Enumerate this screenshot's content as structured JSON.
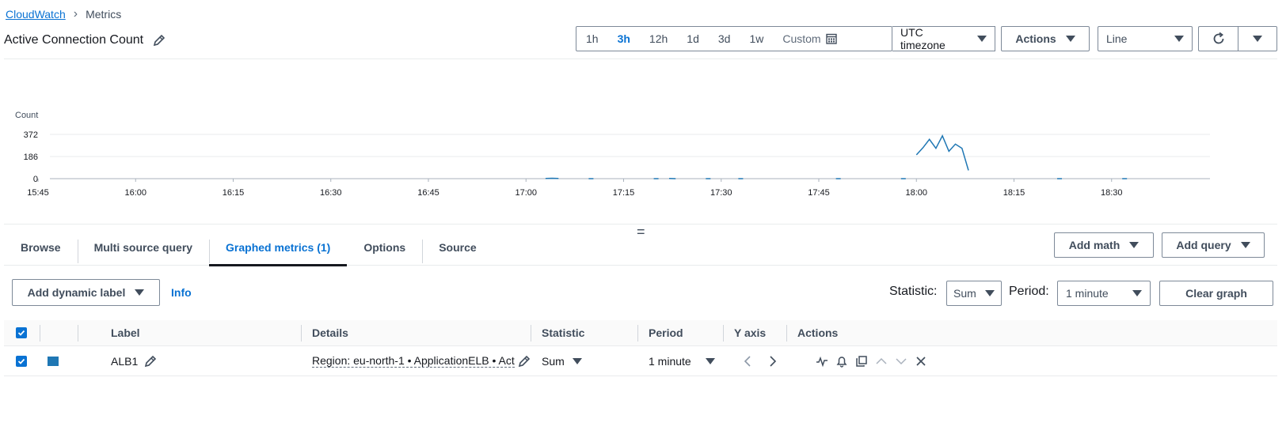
{
  "breadcrumb": {
    "root": "CloudWatch",
    "current": "Metrics"
  },
  "page_title": "Active Connection Count",
  "time_range": {
    "options": [
      "1h",
      "3h",
      "12h",
      "1d",
      "3d",
      "1w"
    ],
    "active": "3h",
    "custom_label": "Custom"
  },
  "timezone": "UTC timezone",
  "toolbar": {
    "actions_label": "Actions",
    "chart_type": "Line"
  },
  "chart_data": {
    "type": "line",
    "ylabel": "Count",
    "y_ticks": [
      "372",
      "186",
      "0"
    ],
    "ylim": [
      0,
      372
    ],
    "x_ticks": [
      "15:45",
      "16:00",
      "16:15",
      "16:30",
      "16:45",
      "17:00",
      "17:15",
      "17:30",
      "17:45",
      "18:00",
      "18:15",
      "18:30"
    ],
    "series": [
      {
        "color": "#1f77b4",
        "points": [
          [
            "17:03",
            1
          ],
          [
            "17:04",
            3
          ],
          [
            "17:05",
            1
          ],
          [
            "17:10",
            0
          ],
          [
            "17:20",
            0
          ],
          [
            "17:22",
            2
          ],
          [
            "17:23",
            0
          ],
          [
            "17:28",
            0
          ],
          [
            "17:33",
            0
          ],
          [
            "17:48",
            0
          ],
          [
            "17:58",
            0
          ],
          [
            "18:00",
            200
          ],
          [
            "18:01",
            260
          ],
          [
            "18:02",
            330
          ],
          [
            "18:03",
            255
          ],
          [
            "18:04",
            360
          ],
          [
            "18:05",
            230
          ],
          [
            "18:06",
            290
          ],
          [
            "18:07",
            255
          ],
          [
            "18:08",
            70
          ],
          [
            "18:22",
            0
          ],
          [
            "18:32",
            0
          ]
        ]
      }
    ]
  },
  "tabs": [
    {
      "label": "Browse",
      "active": false
    },
    {
      "label": "Multi source query",
      "active": false
    },
    {
      "label": "Graphed metrics (1)",
      "active": true
    },
    {
      "label": "Options",
      "active": false
    },
    {
      "label": "Source",
      "active": false
    }
  ],
  "buttons": {
    "add_math": "Add math",
    "add_query": "Add query",
    "add_dynamic_label": "Add dynamic label",
    "info": "Info",
    "clear_graph": "Clear graph"
  },
  "controls": {
    "statistic_label": "Statistic:",
    "statistic_value": "Sum",
    "period_label": "Period:",
    "period_value": "1 minute"
  },
  "table": {
    "headers": [
      "Label",
      "Details",
      "Statistic",
      "Period",
      "Y axis",
      "Actions"
    ],
    "rows": [
      {
        "label": "ALB1",
        "details": "Region: eu-north-1 • ApplicationELB • Act",
        "statistic": "Sum",
        "period": "1 minute",
        "color": "#1f77b4"
      }
    ]
  }
}
